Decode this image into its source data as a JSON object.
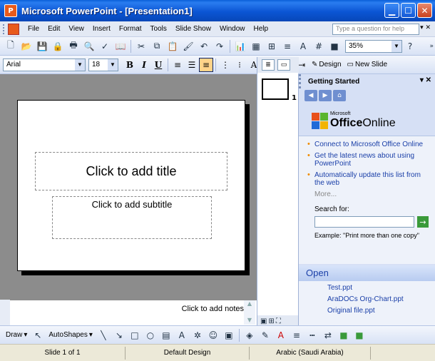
{
  "window": {
    "title": "Microsoft PowerPoint - [Presentation1]",
    "icon": "powerpoint-icon"
  },
  "menu": {
    "items": [
      "File",
      "Edit",
      "View",
      "Insert",
      "Format",
      "Tools",
      "Slide Show",
      "Window",
      "Help"
    ],
    "ask_placeholder": "Type a question for help"
  },
  "toolbar": {
    "zoom": "35%"
  },
  "formatting": {
    "font": "Arial",
    "size": "18",
    "bold": "B",
    "italic": "I",
    "underline": "U",
    "design_label": "Design",
    "new_slide_label": "New Slide"
  },
  "slide": {
    "title_placeholder": "Click to add title",
    "subtitle_placeholder": "Click to add subtitle"
  },
  "notes": {
    "placeholder": "Click to add notes"
  },
  "outline": {
    "slide_number": "1"
  },
  "taskpane": {
    "title": "Getting Started",
    "logo_small": "Microsoft",
    "logo_main": "Office",
    "logo_suffix": "Online",
    "links": [
      "Connect to Microsoft Office Online",
      "Get the latest news about using PowerPoint",
      "Automatically update this list from the web"
    ],
    "more": "More...",
    "search_label": "Search for:",
    "example": "Example: \"Print more than one copy\"",
    "open_title": "Open",
    "files": [
      "Test.ppt",
      "AraDOCs Org-Chart.ppt",
      "Original file.ppt"
    ]
  },
  "drawbar": {
    "draw_label": "Draw",
    "autoshapes_label": "AutoShapes"
  },
  "status": {
    "slide": "Slide 1 of 1",
    "design": "Default Design",
    "language": "Arabic (Saudi Arabia)"
  }
}
